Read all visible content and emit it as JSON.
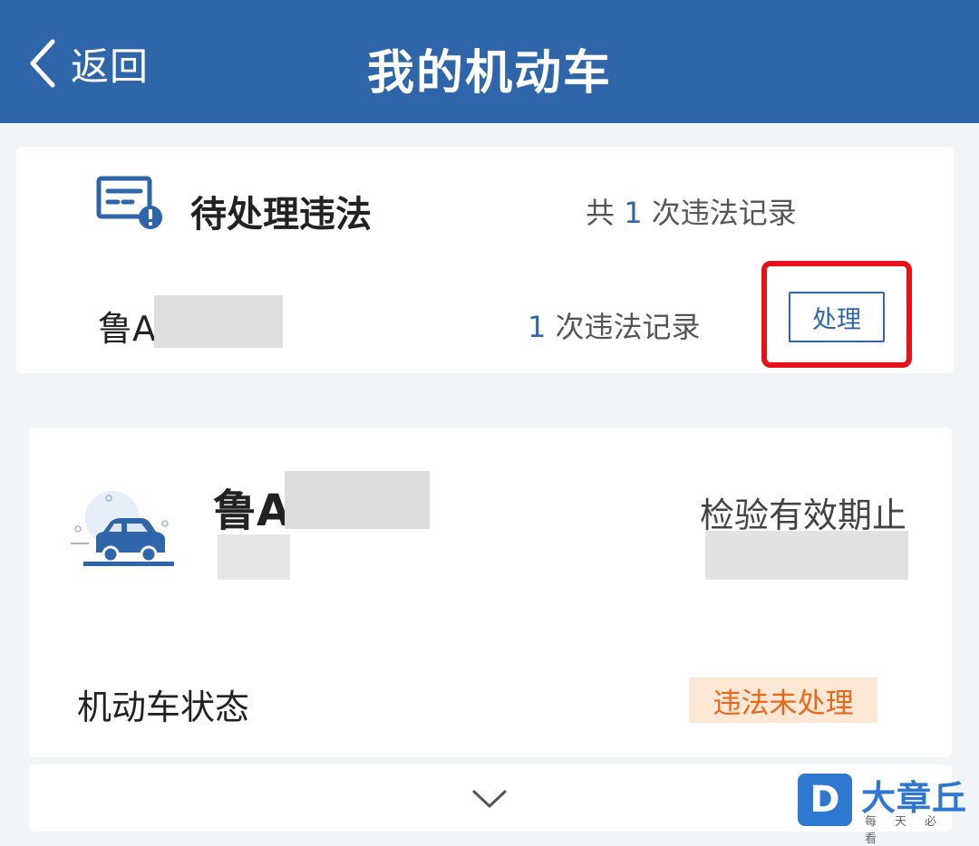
{
  "header": {
    "back_label": "返回",
    "title": "我的机动车"
  },
  "violations_card": {
    "title": "待处理违法",
    "summary_prefix": "共",
    "summary_count": "1",
    "summary_suffix": "次违法记录",
    "plate_prefix": "鲁A",
    "row_count": "1",
    "row_count_suffix": "次违法记录",
    "action_label": "处理",
    "icons": [
      "document-alert-icon"
    ]
  },
  "vehicle_card": {
    "plate_prefix": "鲁A",
    "inspection_label": "检验有效期止",
    "status_label": "机动车状态",
    "status_badge": "违法未处理",
    "icons": [
      "car-icon"
    ]
  },
  "footer": {
    "icons": [
      "chevron-down-icon"
    ]
  },
  "watermark": {
    "logo_letter": "D",
    "name": "大章丘",
    "slogan": "每天必看"
  },
  "colors": {
    "header_bg": "#2f65a9",
    "accent": "#2f65a9",
    "highlight_border": "#e7111a",
    "badge_bg": "#fde8d6",
    "badge_text": "#e8671c"
  }
}
